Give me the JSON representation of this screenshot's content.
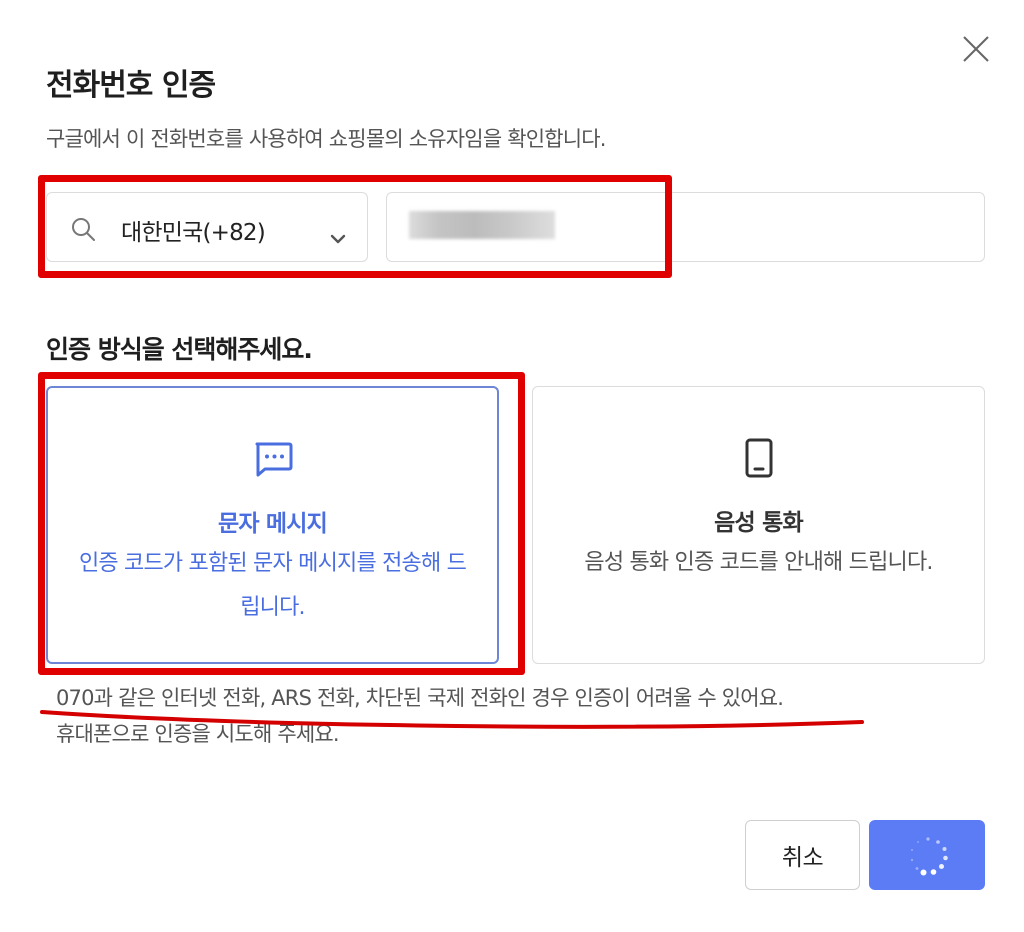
{
  "dialog": {
    "title": "전화번호 인증",
    "subtitle": "구글에서 이 전화번호를 사용하여 쇼핑몰의 소유자임을 확인합니다."
  },
  "phone": {
    "country_value": "대한민국(+82)",
    "number_value": ""
  },
  "method": {
    "heading": "인증 방식을 선택해주세요.",
    "options": [
      {
        "title": "문자 메시지",
        "description": "인증 코드가 포함된 문자 메시지를 전송해 드립니다.",
        "icon": "message-icon",
        "selected": true
      },
      {
        "title": "음성 통화",
        "description": "음성 통화 인증 코드를 안내해 드립니다.",
        "icon": "phone-icon",
        "selected": false
      }
    ]
  },
  "notice": {
    "line1": "070과 같은 인터넷 전화, ARS 전화, 차단된 국제 전화인 경우 인증이 어려울 수 있어요.",
    "line2": "휴대폰으로 인증을 시도해 주세요."
  },
  "buttons": {
    "cancel": "취소",
    "confirm_state": "loading"
  },
  "colors": {
    "accent": "#5b7cf5",
    "selected_text": "#4a6ee0",
    "annotation_red": "#e00000"
  }
}
